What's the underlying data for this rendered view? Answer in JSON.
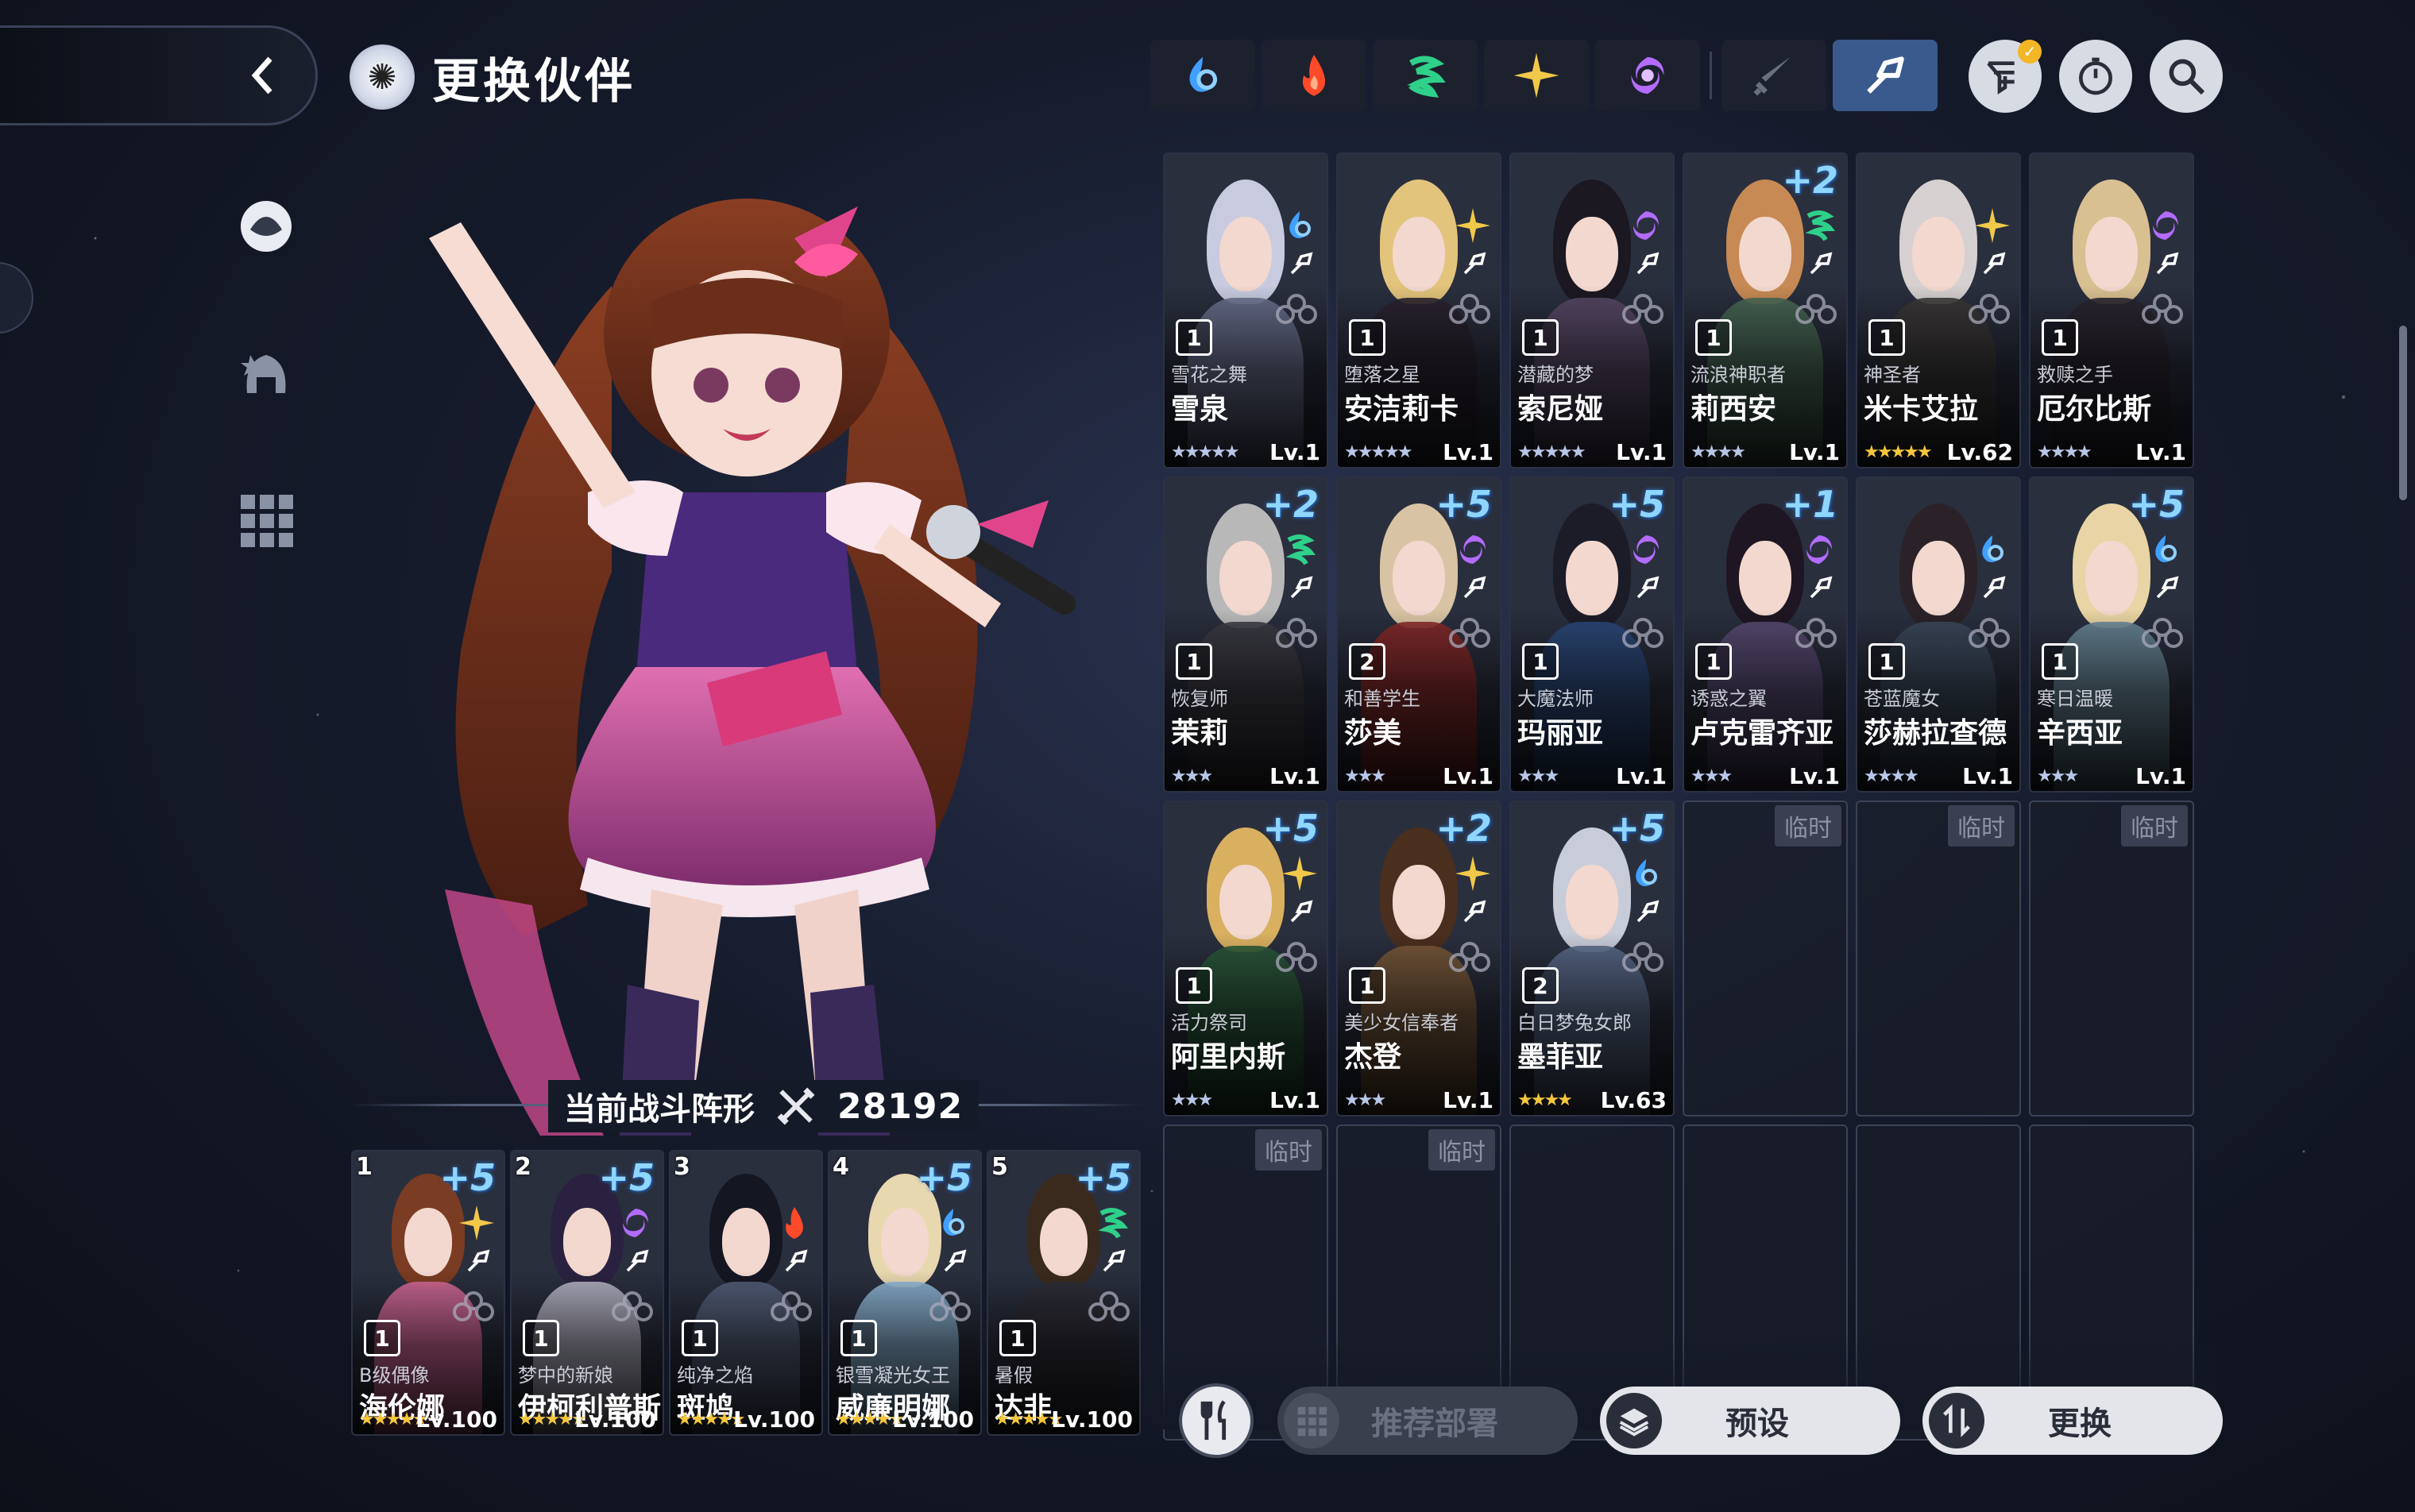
{
  "header": {
    "title": "更换伙伴"
  },
  "formation": {
    "label": "当前战斗阵形",
    "power": "28192"
  },
  "team": [
    {
      "slot": "1",
      "plus": "+5",
      "element": "light",
      "title": "B级偶像",
      "name": "海伦娜",
      "grade": "1",
      "stars": "★★★★★",
      "level": "Lv.100",
      "hair": "#7a3c22",
      "body": "#d76a9a"
    },
    {
      "slot": "2",
      "plus": "+5",
      "element": "dark",
      "title": "梦中的新娘",
      "name": "伊柯利普斯",
      "grade": "1",
      "stars": "★★★★★",
      "level": "Lv.100",
      "hair": "#2a2140",
      "body": "#b8b7c8"
    },
    {
      "slot": "3",
      "plus": "",
      "element": "fire",
      "title": "纯净之焰",
      "name": "斑鸠",
      "grade": "1",
      "stars": "★★★★★",
      "level": "Lv.100",
      "hair": "#141622",
      "body": "#54607a"
    },
    {
      "slot": "4",
      "plus": "+5",
      "element": "water",
      "title": "银雪凝光女王",
      "name": "威廉明娜",
      "grade": "1",
      "stars": "★★★★★",
      "level": "Lv.100",
      "hair": "#e8d8b0",
      "body": "#8fb8d8"
    },
    {
      "slot": "5",
      "plus": "+5",
      "element": "wind",
      "title": "暑假",
      "name": "达非",
      "grade": "1",
      "stars": "★★★★★",
      "level": "Lv.100",
      "hair": "#3a2a1e",
      "body": "#2e2e36"
    }
  ],
  "roster": [
    {
      "plus": "",
      "element": "water",
      "title": "雪花之舞",
      "name": "雪泉",
      "grade": "1",
      "stars": "★★★★★",
      "star_color": "silver",
      "level": "Lv.1",
      "hair": "#c8cbe0",
      "body": "#6c7290"
    },
    {
      "plus": "",
      "element": "light",
      "title": "堕落之星",
      "name": "安洁莉卡",
      "grade": "1",
      "stars": "★★★★★",
      "star_color": "silver",
      "level": "Lv.1",
      "hair": "#e2c47c",
      "body": "#2a2430"
    },
    {
      "plus": "",
      "element": "dark",
      "title": "潜藏的梦",
      "name": "索尼娅",
      "grade": "1",
      "stars": "★★★★★",
      "star_color": "silver",
      "level": "Lv.1",
      "hair": "#1c1822",
      "body": "#5a4a68"
    },
    {
      "plus": "+2",
      "element": "wind",
      "title": "流浪神职者",
      "name": "莉西安",
      "grade": "1",
      "stars": "★★★★",
      "star_color": "silver",
      "level": "Lv.1",
      "hair": "#c78a54",
      "body": "#4a6a58"
    },
    {
      "plus": "",
      "element": "light",
      "title": "神圣者",
      "name": "米卡艾拉",
      "grade": "1",
      "stars": "★★★★★",
      "star_color": "gold",
      "level": "Lv.62",
      "hair": "#d6d0d0",
      "body": "#3c3838"
    },
    {
      "plus": "",
      "element": "dark",
      "title": "救赎之手",
      "name": "厄尔比斯",
      "grade": "1",
      "stars": "★★★★",
      "star_color": "silver",
      "level": "Lv.1",
      "hair": "#d8c090",
      "body": "#2a2630"
    },
    {
      "plus": "+2",
      "element": "wind",
      "title": "恢复师",
      "name": "茉莉",
      "grade": "1",
      "stars": "★★★",
      "star_color": "silver",
      "level": "Lv.1",
      "hair": "#b8b8b8",
      "body": "#3c3c44"
    },
    {
      "plus": "+5",
      "element": "dark",
      "title": "和善学生",
      "name": "莎美",
      "grade": "2",
      "stars": "★★★",
      "star_color": "silver",
      "level": "Lv.1",
      "hair": "#d8c4a4",
      "body": "#8a2a2a"
    },
    {
      "plus": "+5",
      "element": "dark",
      "title": "大魔法师",
      "name": "玛丽亚",
      "grade": "1",
      "stars": "★★★",
      "star_color": "silver",
      "level": "Lv.1",
      "hair": "#1c1c28",
      "body": "#2c4a7c"
    },
    {
      "plus": "+1",
      "element": "dark",
      "title": "诱惑之翼",
      "name": "卢克雷齐亚",
      "grade": "1",
      "stars": "★★★",
      "star_color": "silver",
      "level": "Lv.1",
      "hair": "#1e1622",
      "body": "#5a4c74"
    },
    {
      "plus": "",
      "element": "water",
      "title": "苍蓝魔女",
      "name": "莎赫拉查德",
      "grade": "1",
      "stars": "★★★★",
      "star_color": "silver",
      "level": "Lv.1",
      "hair": "#2a2228",
      "body": "#3c4a5c"
    },
    {
      "plus": "+5",
      "element": "water",
      "title": "寒日温暖",
      "name": "辛西亚",
      "grade": "1",
      "stars": "★★★",
      "star_color": "silver",
      "level": "Lv.1",
      "hair": "#e8d4a4",
      "body": "#6a8a9a"
    },
    {
      "plus": "+5",
      "element": "light",
      "title": "活力祭司",
      "name": "阿里内斯",
      "grade": "1",
      "stars": "★★★",
      "star_color": "silver",
      "level": "Lv.1",
      "hair": "#d8b060",
      "body": "#2a5a3a"
    },
    {
      "plus": "+2",
      "element": "light",
      "title": "美少女信奉者",
      "name": "杰登",
      "grade": "1",
      "stars": "★★★",
      "star_color": "silver",
      "level": "Lv.1",
      "hair": "#4a2e1e",
      "body": "#7a5a3a"
    },
    {
      "plus": "+5",
      "element": "water",
      "title": "白日梦兔女郎",
      "name": "墨菲亚",
      "grade": "2",
      "stars": "★★★★",
      "star_color": "gold",
      "level": "Lv.63",
      "hair": "#c8ccd8",
      "body": "#5a6a8a"
    }
  ],
  "empty_slots": [
    {
      "tag": "临时"
    },
    {
      "tag": "临时"
    },
    {
      "tag": "临时"
    },
    {
      "tag": "临时"
    },
    {
      "tag": "临时"
    },
    {
      "tag": ""
    },
    {
      "tag": ""
    },
    {
      "tag": ""
    },
    {
      "tag": ""
    }
  ],
  "buttons": {
    "recommend": "推荐部署",
    "preset": "预设",
    "swap": "更换"
  },
  "colors": {
    "water": "#3fa0ff",
    "fire": "#ff4a2a",
    "wind": "#2fd08a",
    "light": "#f1c84a",
    "dark": "#b36cff",
    "active_filter": "#3a5a8e"
  }
}
